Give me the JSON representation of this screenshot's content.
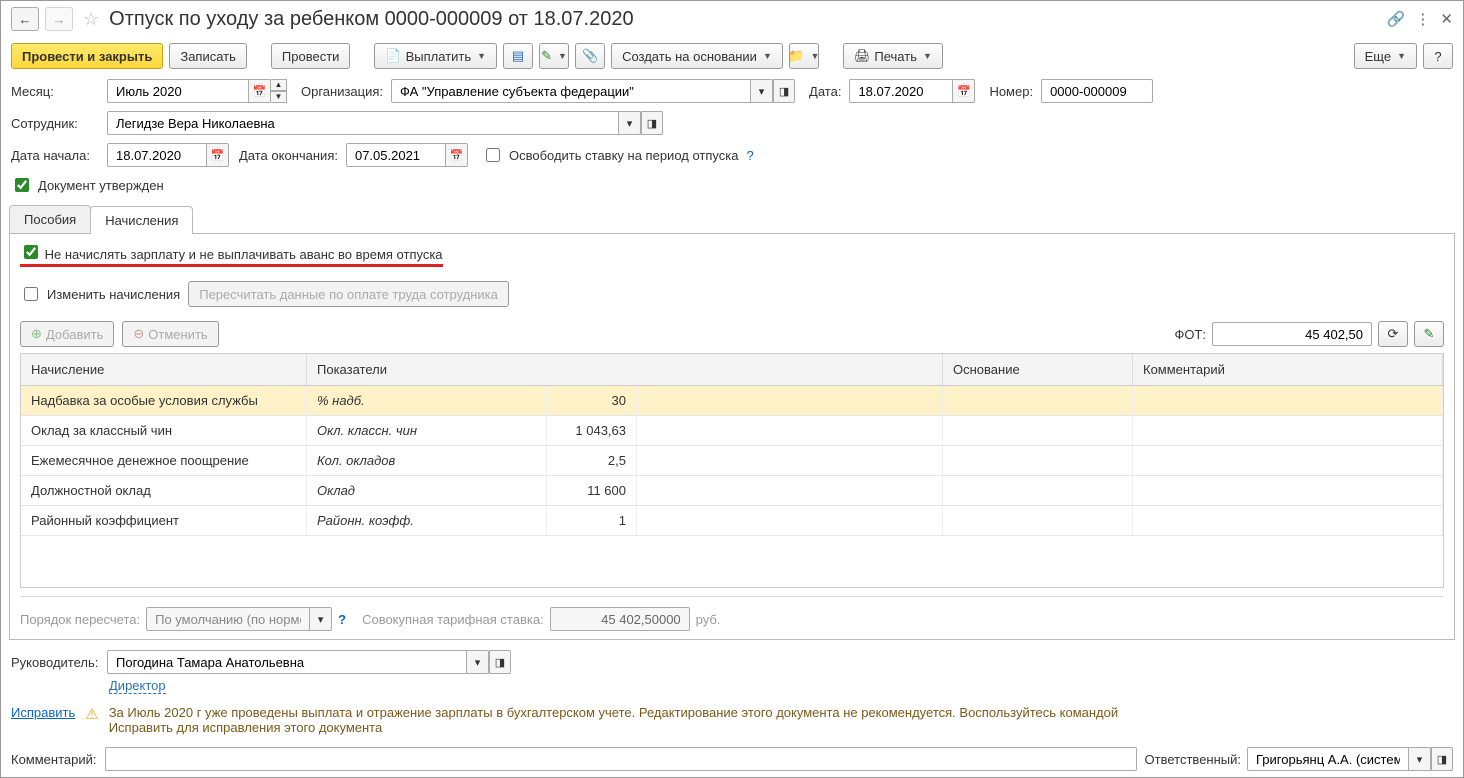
{
  "header": {
    "title": "Отпуск по уходу за ребенком 0000-000009 от 18.07.2020"
  },
  "toolbar": {
    "post_close": "Провести и закрыть",
    "save": "Записать",
    "post": "Провести",
    "pay": "Выплатить",
    "create_based": "Создать на основании",
    "print": "Печать",
    "more": "Еще"
  },
  "form": {
    "month_label": "Месяц:",
    "month_value": "Июль 2020",
    "org_label": "Организация:",
    "org_value": "ФА \"Управление субъекта федерации\"",
    "date_label": "Дата:",
    "date_value": "18.07.2020",
    "number_label": "Номер:",
    "number_value": "0000-000009",
    "employee_label": "Сотрудник:",
    "employee_value": "Легидзе Вера Николаевна",
    "start_label": "Дата начала:",
    "start_value": "18.07.2020",
    "end_label": "Дата окончания:",
    "end_value": "07.05.2021",
    "release_rate": "Освободить ставку на период отпуска",
    "approved": "Документ утвержден"
  },
  "tabs": {
    "benefits": "Пособия",
    "accruals": "Начисления"
  },
  "accruals": {
    "no_salary": "Не начислять зарплату и не выплачивать аванс во время отпуска",
    "change_accruals": "Изменить начисления",
    "recalc": "Пересчитать данные по оплате труда сотрудника",
    "add": "Добавить",
    "cancel": "Отменить",
    "fot_label": "ФОТ:",
    "fot_value": "45 402,50",
    "columns": {
      "accrual": "Начисление",
      "indicators": "Показатели",
      "basis": "Основание",
      "comment": "Комментарий"
    },
    "rows": [
      {
        "name": "Надбавка за особые условия службы",
        "indicator": "% надб.",
        "value": "30"
      },
      {
        "name": "Оклад за классный чин",
        "indicator": "Окл. классн. чин",
        "value": "1 043,63"
      },
      {
        "name": "Ежемесячное денежное поощрение",
        "indicator": "Кол. окладов",
        "value": "2,5"
      },
      {
        "name": "Должностной оклад",
        "indicator": "Оклад",
        "value": "11 600"
      },
      {
        "name": "Районный коэффициент",
        "indicator": "Районн. коэфф.",
        "value": "1"
      }
    ],
    "recalc_order_label": "Порядок пересчета:",
    "recalc_order_value": "По умолчанию (по норме",
    "tariff_label": "Совокупная тарифная ставка:",
    "tariff_value": "45 402,50000",
    "tariff_unit": "руб."
  },
  "manager": {
    "label": "Руководитель:",
    "value": "Погодина Тамара Анатольевна",
    "position": "Директор"
  },
  "fix_link": "Исправить",
  "warning": "За Июль 2020 г уже проведены выплата и отражение зарплаты в бухгалтерском учете. Редактирование этого документа не рекомендуется. Воспользуйтесь командой Исправить для исправления этого документа",
  "comment_label": "Комментарий:",
  "responsible_label": "Ответственный:",
  "responsible_value": "Григорьянц А.А. (системн"
}
